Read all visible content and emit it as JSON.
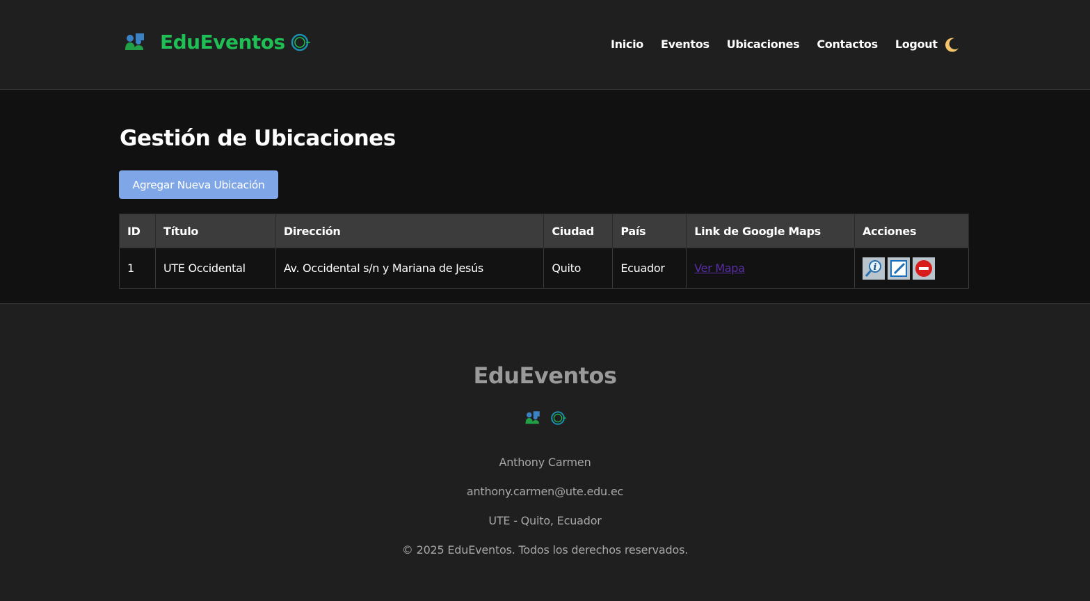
{
  "header": {
    "brand": "EduEventos",
    "nav": [
      "Inicio",
      "Eventos",
      "Ubicaciones",
      "Contactos",
      "Logout"
    ],
    "theme_icon": "moon-icon"
  },
  "main": {
    "title": "Gestión de Ubicaciones",
    "add_button": "Agregar Nueva Ubicación",
    "table": {
      "headers": [
        "ID",
        "Título",
        "Dirección",
        "Ciudad",
        "País",
        "Link de Google Maps",
        "Acciones"
      ],
      "rows": [
        {
          "id": "1",
          "titulo": "UTE Occidental",
          "direccion": "Av. Occidental s/n y Mariana de Jesús",
          "ciudad": "Quito",
          "pais": "Ecuador",
          "link": "Ver Mapa",
          "actions": [
            "view-icon",
            "edit-icon",
            "delete-icon"
          ]
        }
      ]
    }
  },
  "footer": {
    "title": "EduEventos",
    "author": "Anthony Carmen",
    "email": "anthony.carmen@ute.edu.ec",
    "location": "UTE - Quito, Ecuador",
    "copyright": "© 2025 EduEventos. Todos los derechos reservados."
  },
  "colors": {
    "brand": "#1fbf55",
    "button": "#7fa6e6",
    "link": "#5a2fa8"
  }
}
